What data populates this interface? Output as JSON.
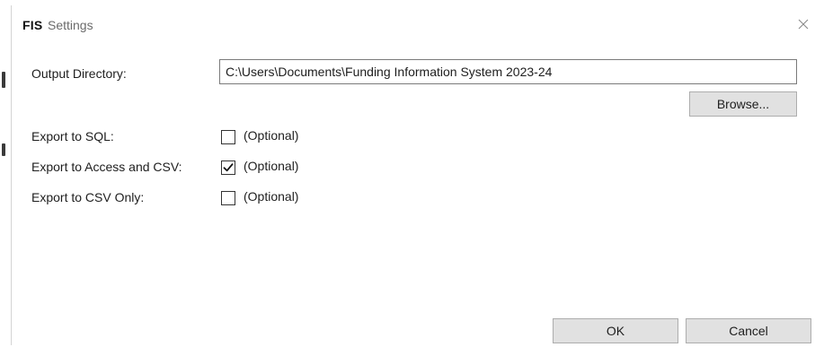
{
  "window": {
    "app_badge": "FIS",
    "title": "Settings"
  },
  "output_directory": {
    "label": "Output Directory:",
    "value": "C:\\Users\\Documents\\Funding Information System 2023-24"
  },
  "browse_label": "Browse...",
  "options": [
    {
      "label": "Export to SQL:",
      "checked": false,
      "note": "(Optional)"
    },
    {
      "label": "Export to Access and CSV:",
      "checked": true,
      "note": "(Optional)"
    },
    {
      "label": "Export to CSV Only:",
      "checked": false,
      "note": "(Optional)"
    }
  ],
  "buttons": {
    "ok": "OK",
    "cancel": "Cancel"
  }
}
